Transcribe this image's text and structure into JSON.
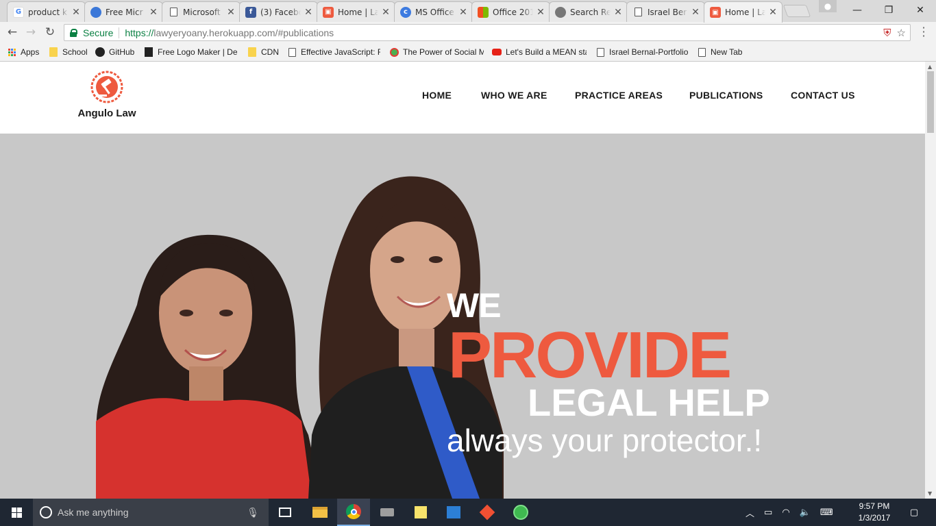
{
  "browser": {
    "tabs": [
      {
        "title": "product k",
        "icon": "google-icon",
        "color": "#4285f4",
        "active": false
      },
      {
        "title": "Free Micr",
        "icon": "windows-globe-icon",
        "color": "#3c78d8",
        "active": false
      },
      {
        "title": "Microsoft",
        "icon": "page-icon",
        "color": "#888888",
        "active": false
      },
      {
        "title": "(3) Facebo",
        "icon": "facebook-icon",
        "color": "#3b5998",
        "active": false
      },
      {
        "title": "Home | La",
        "icon": "angulo-law-icon",
        "color": "#ee5a3f",
        "active": false
      },
      {
        "title": "MS Office",
        "icon": "ms-office-icon",
        "color": "#3d7be0",
        "active": false
      },
      {
        "title": "Office 201",
        "icon": "office-tiles-icon",
        "color": "#f25022",
        "active": false
      },
      {
        "title": "Search Re",
        "icon": "search-result-icon",
        "color": "#777777",
        "active": false
      },
      {
        "title": "Israel Ber",
        "icon": "page-icon",
        "color": "#888888",
        "active": false
      },
      {
        "title": "Home | La",
        "icon": "angulo-law-icon",
        "color": "#ee5a3f",
        "active": true
      }
    ],
    "tab_close_glyph": "✕",
    "window_controls": {
      "minimize": "—",
      "restore": "❐",
      "close": "✕"
    },
    "address": {
      "security_label": "Secure",
      "scheme": "https://",
      "host_path": "lawyeryoany.herokuapp.com/#publications"
    },
    "bookmarks": [
      {
        "label": "Apps",
        "icon": "apps-grid-icon"
      },
      {
        "label": "School",
        "icon": "folder-icon"
      },
      {
        "label": "GitHub",
        "icon": "github-icon"
      },
      {
        "label": "Free Logo Maker | De",
        "icon": "logo-maker-icon"
      },
      {
        "label": "CDN",
        "icon": "folder-icon"
      },
      {
        "label": "Effective JavaScript: Fr",
        "icon": "page-icon"
      },
      {
        "label": "The Power of Social M",
        "icon": "social-icon"
      },
      {
        "label": "Let's Build a MEAN sta",
        "icon": "youtube-icon"
      },
      {
        "label": "Israel Bernal-Portfolio",
        "icon": "page-icon"
      },
      {
        "label": "New Tab",
        "icon": "page-icon"
      }
    ]
  },
  "site": {
    "logo_text": "Angulo Law",
    "nav": [
      "HOME",
      "WHO WE ARE",
      "PRACTICE AREAS",
      "PUBLICATIONS",
      "CONTACT US"
    ],
    "hero": {
      "line1": "WE",
      "line2": "PROVIDE",
      "line3": "LEGAL HELP",
      "tagline": "always your protector.!"
    },
    "colors": {
      "accent": "#ee5a3f",
      "hero_bg": "#c8c8c8"
    }
  },
  "taskbar": {
    "search_placeholder": "Ask me anything",
    "apps": [
      {
        "name": "task-view-icon",
        "state": "normal"
      },
      {
        "name": "file-explorer-icon",
        "state": "normal"
      },
      {
        "name": "chrome-icon",
        "state": "active"
      },
      {
        "name": "app-icon",
        "state": "normal"
      },
      {
        "name": "sticky-notes-icon",
        "state": "normal"
      },
      {
        "name": "outlook-icon",
        "state": "normal"
      },
      {
        "name": "git-icon",
        "state": "normal"
      },
      {
        "name": "atom-icon",
        "state": "normal"
      }
    ],
    "time": "9:57 PM",
    "date": "1/3/2017"
  }
}
